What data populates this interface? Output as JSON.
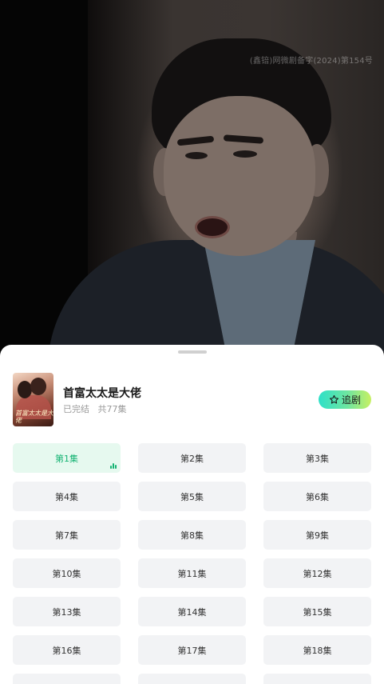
{
  "video": {
    "watermark": "(鑫锫)网微剧备字(2024)第154号"
  },
  "drama": {
    "title": "首富太太是大佬",
    "status": "已完结",
    "total": "共77集",
    "poster_text": "首富太太是大佬",
    "follow_label": "追剧"
  },
  "episodes": [
    {
      "label": "第1集",
      "active": true
    },
    {
      "label": "第2集"
    },
    {
      "label": "第3集"
    },
    {
      "label": "第4集"
    },
    {
      "label": "第5集"
    },
    {
      "label": "第6集"
    },
    {
      "label": "第7集"
    },
    {
      "label": "第8集"
    },
    {
      "label": "第9集"
    },
    {
      "label": "第10集"
    },
    {
      "label": "第11集"
    },
    {
      "label": "第12集"
    },
    {
      "label": "第13集"
    },
    {
      "label": "第14集"
    },
    {
      "label": "第15集"
    },
    {
      "label": "第16集"
    },
    {
      "label": "第17集"
    },
    {
      "label": "第18集"
    },
    {
      "label": ""
    },
    {
      "label": ""
    },
    {
      "label": ""
    }
  ],
  "colors": {
    "accent": "#15b373",
    "active_bg": "#e6f9ef",
    "chip_bg": "#f2f3f5"
  },
  "icons": {
    "follow": "star-outline-icon",
    "playing": "playing-bars-icon"
  }
}
